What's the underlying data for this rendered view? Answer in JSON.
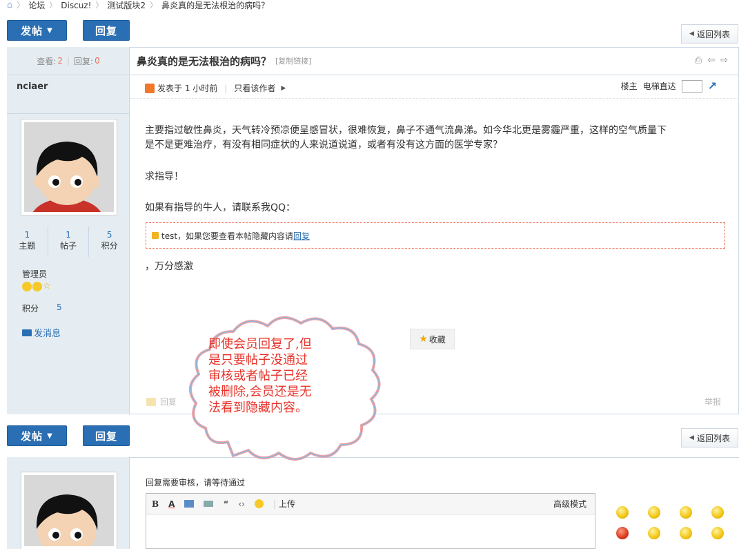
{
  "breadcrumb": {
    "items": [
      "论坛",
      "Discuz!",
      "测试版块2",
      "鼻炎真的是无法根治的病吗？"
    ]
  },
  "toolbar": {
    "post_label": "发帖",
    "reply_label": "回复",
    "back_label": "返回列表"
  },
  "thread": {
    "views_label": "查看:",
    "views": "2",
    "replies_label": "回复:",
    "replies": "0",
    "title": "鼻炎真的是无法根治的病吗？",
    "copy_link": "[复制链接]"
  },
  "author": {
    "name": "nciaer",
    "topics": "1",
    "topics_label": "主题",
    "posts": "1",
    "posts_label": "帖子",
    "credits": "5",
    "credits_label": "积分",
    "group": "管理员",
    "credits_row_label": "积分",
    "credits_row_value": "5",
    "message_label": "发消息"
  },
  "post_meta": {
    "posted_label": "发表于 1 小时前",
    "only_author": "只看该作者",
    "floor": "楼主",
    "elevator": "电梯直达"
  },
  "post_body": {
    "p1": "主要指过敏性鼻炎，天气转冷预凉便呈感冒状，很难恢复，鼻子不通气流鼻涕。如今华北更是雾霾严重，这样的空气质量下",
    "p1b": "是不是更难治疗，有没有相同症状的人来说道说道，或者有没有这方面的医学专家？",
    "p2": "求指导！",
    "p3": "如果有指导的牛人，请联系我QQ：",
    "hide_prefix": "test，如果您要查看本帖隐藏内容请",
    "hide_link": "回复",
    "p4": "，万分感激"
  },
  "actions": {
    "favorite": "收藏",
    "reply": "回复",
    "report": "举报"
  },
  "callout": {
    "lines": [
      "即使会员回复了,但",
      "是只要帖子没通过",
      "审核或者帖子已经",
      "被删除,会员还是无",
      "法看到隐藏内容。"
    ]
  },
  "reply_form": {
    "notice": "回复需要审核，请等待通过",
    "upload": "上传",
    "advanced": "高级模式",
    "bold": "B",
    "font_color": "A"
  },
  "colors": {
    "accent": "#2a6fb3",
    "sidebar_bg": "#e5edf2",
    "highlight": "#f26c4f"
  }
}
